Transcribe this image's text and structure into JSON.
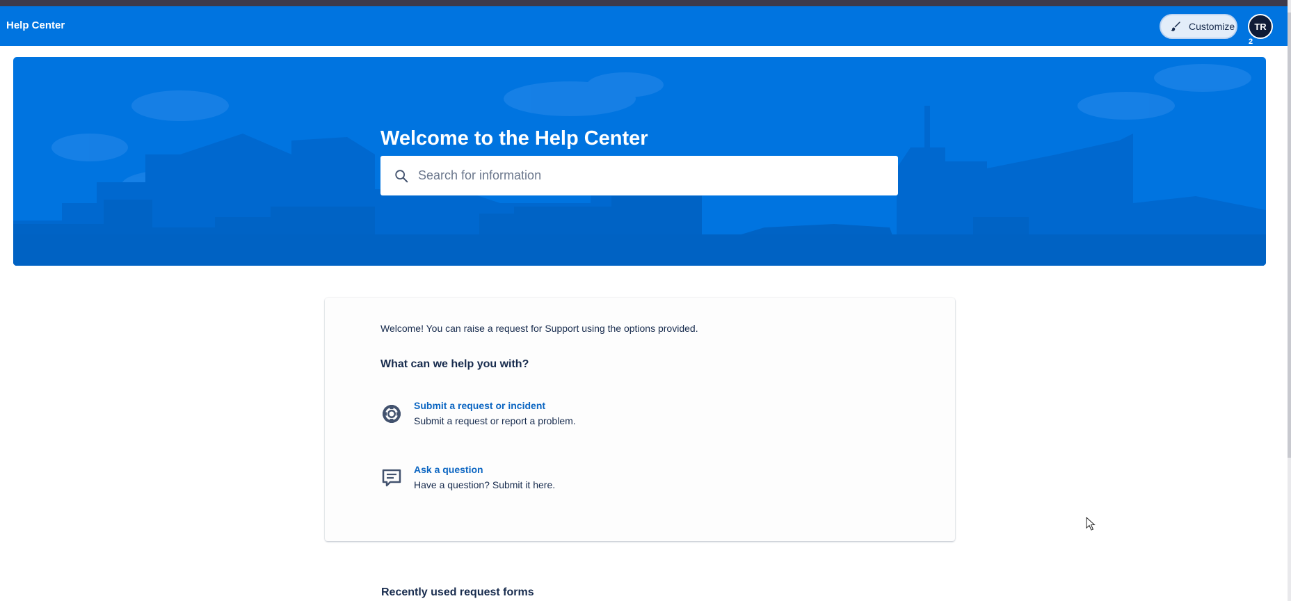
{
  "app": {
    "title": "Help Center"
  },
  "topbar": {
    "customize_label": "Customize",
    "avatar_initials": "TR",
    "avatar_badge": "2"
  },
  "hero": {
    "heading": "Welcome to the Help Center",
    "search_placeholder": "Search for information"
  },
  "main": {
    "welcome_text": "Welcome! You can raise a request for Support using the options provided.",
    "help_heading": "What can we help you with?",
    "options": [
      {
        "icon": "lifebuoy-icon",
        "title": "Submit a request or incident",
        "description": "Submit a request or report a problem."
      },
      {
        "icon": "chat-bubble-icon",
        "title": "Ask a question",
        "description": "Have a question? Submit it here."
      }
    ],
    "recent_heading": "Recently used request forms"
  },
  "colors": {
    "brand_blue": "#0074e0",
    "link_blue": "#0c66c2",
    "text_dark": "#172b4d",
    "avatar_bg": "#0f1b36"
  }
}
